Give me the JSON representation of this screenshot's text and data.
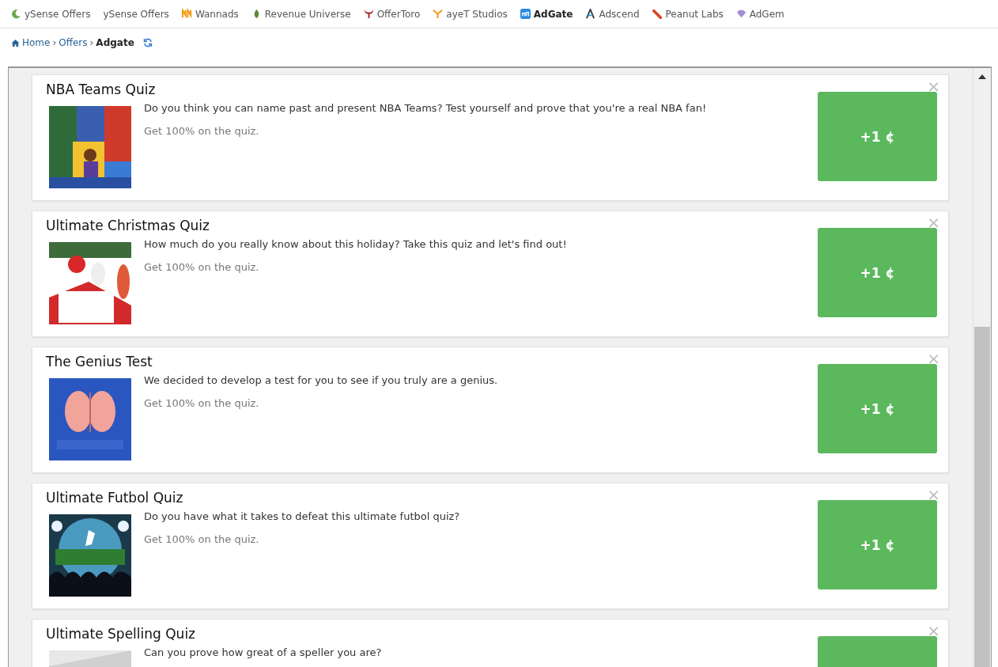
{
  "nav": [
    {
      "label": "ySense Offers",
      "selected": false
    },
    {
      "label": "ySense Offers",
      "selected": false
    },
    {
      "label": "Wannads",
      "selected": false
    },
    {
      "label": "Revenue Universe",
      "selected": false
    },
    {
      "label": "OfferToro",
      "selected": false
    },
    {
      "label": "ayeT Studios",
      "selected": false
    },
    {
      "label": "AdGate",
      "selected": true
    },
    {
      "label": "Adscend",
      "selected": false
    },
    {
      "label": "Peanut Labs",
      "selected": false
    },
    {
      "label": "AdGem",
      "selected": false
    }
  ],
  "breadcrumb": {
    "links": [
      "Home",
      "Offers"
    ],
    "separator": "›",
    "current": "Adgate"
  },
  "offers": [
    {
      "title": "NBA Teams Quiz",
      "description": "Do you think you can name past and present NBA Teams? Test yourself and prove that you're a real NBA fan!",
      "requirement": "Get 100% on the quiz.",
      "reward": "+1 ¢",
      "close": "×"
    },
    {
      "title": "Ultimate Christmas Quiz",
      "description": "How much do you really know about this holiday? Take this quiz and let's find out!",
      "requirement": "Get 100% on the quiz.",
      "reward": "+1 ¢",
      "close": "×"
    },
    {
      "title": "The Genius Test",
      "description": "We decided to develop a test for you to see if you truly are a genius.",
      "requirement": "Get 100% on the quiz.",
      "reward": "+1 ¢",
      "close": "×"
    },
    {
      "title": "Ultimate Futbol Quiz",
      "description": "Do you have what it takes to defeat this ultimate futbol quiz?",
      "requirement": "Get 100% on the quiz.",
      "reward": "+1 ¢",
      "close": "×"
    },
    {
      "title": "Ultimate Spelling Quiz",
      "description": "Can you prove how great of a speller you are?",
      "close": "×"
    }
  ]
}
